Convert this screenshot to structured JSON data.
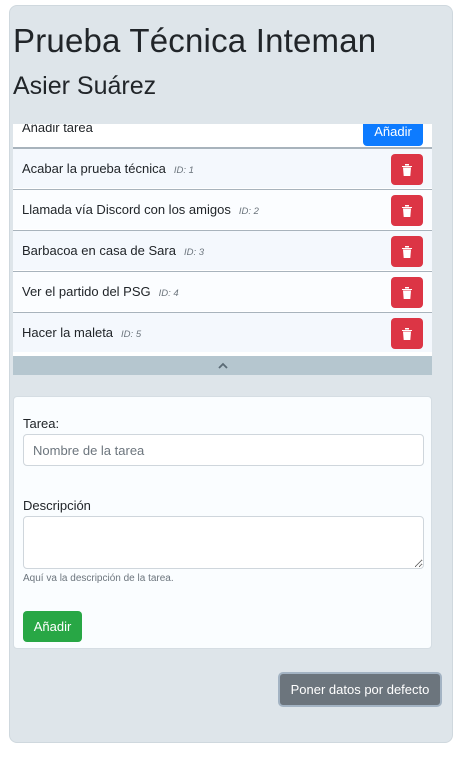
{
  "header": {
    "title": "Prueba Técnica Inteman",
    "subtitle": "Asier Suárez"
  },
  "list_header": {
    "partial_label": "Añadir tarea",
    "partial_button": "Añadir"
  },
  "tasks": [
    {
      "name": "Acabar la prueba técnica",
      "id": "ID: 1"
    },
    {
      "name": "Llamada vía Discord con los amigos",
      "id": "ID: 2"
    },
    {
      "name": "Barbacoa en casa de Sara",
      "id": "ID: 3"
    },
    {
      "name": "Ver el partido del PSG",
      "id": "ID: 4"
    },
    {
      "name": "Hacer la maleta",
      "id": "ID: 5"
    }
  ],
  "form": {
    "task_label": "Tarea:",
    "task_placeholder": "Nombre de la tarea",
    "task_value": "",
    "description_label": "Descripción",
    "description_value": "",
    "help_text": "Aquí va la descripción de la tarea.",
    "submit_label": "Añadir"
  },
  "footer": {
    "default_button": "Poner datos por defecto"
  },
  "icons": {
    "delete": "trash-icon",
    "collapse": "chevron-up-icon"
  },
  "colors": {
    "danger": "#dc3545",
    "primary": "#0d7bff",
    "success": "#28a745",
    "secondary": "#6c757d"
  }
}
